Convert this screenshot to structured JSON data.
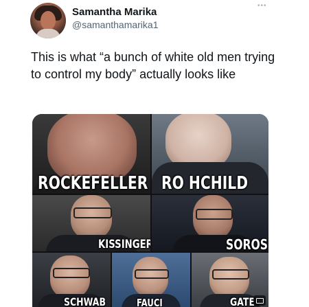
{
  "user": {
    "name": "Samantha Marika",
    "handle": "@samanthamarika1"
  },
  "tweet": {
    "text": "This is what “a bunch of white old men trying to control my body” actually looks like"
  },
  "media": {
    "captions": {
      "rockefeller": "ROCKEFELLER",
      "rothchild": "RO HCHILD",
      "kissinger": "KISSINGER",
      "soros": "SOROS",
      "schwab": "SCHWAB",
      "fauci": "FAUCI",
      "gates": "GATE"
    }
  }
}
